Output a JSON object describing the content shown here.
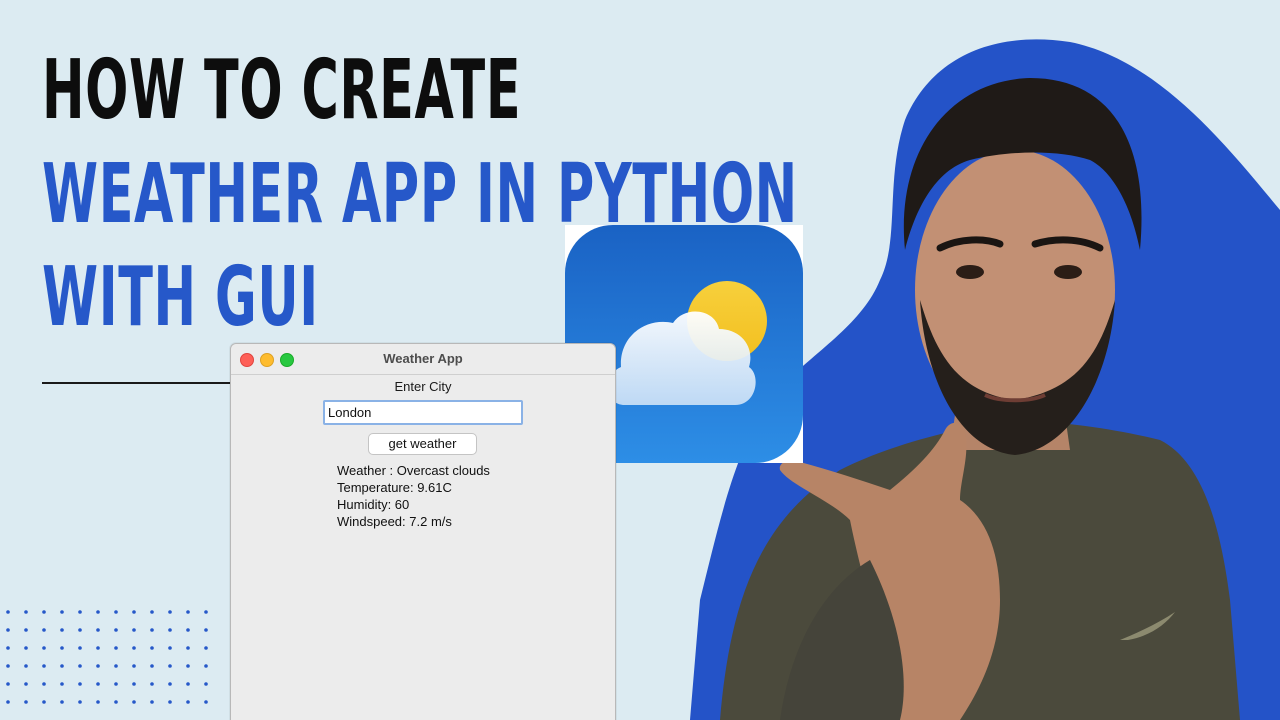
{
  "headline": {
    "line1": "HOW TO CREATE",
    "line2": "WEATHER APP IN PYTHON",
    "line3": "WITH GUI"
  },
  "colors": {
    "background": "#dcebf2",
    "accent_blue": "#2658c9",
    "headline_dark": "#0d0d0d"
  },
  "app_icon": {
    "name": "weather-app-icon"
  },
  "weather_window": {
    "title": "Weather App",
    "enter_city_label": "Enter City",
    "city_value": "London",
    "button_label": "get weather",
    "results": [
      "Weather : Overcast clouds",
      "Temperature: 9.61C",
      "Humidity: 60",
      "Windspeed: 7.2 m/s"
    ]
  }
}
